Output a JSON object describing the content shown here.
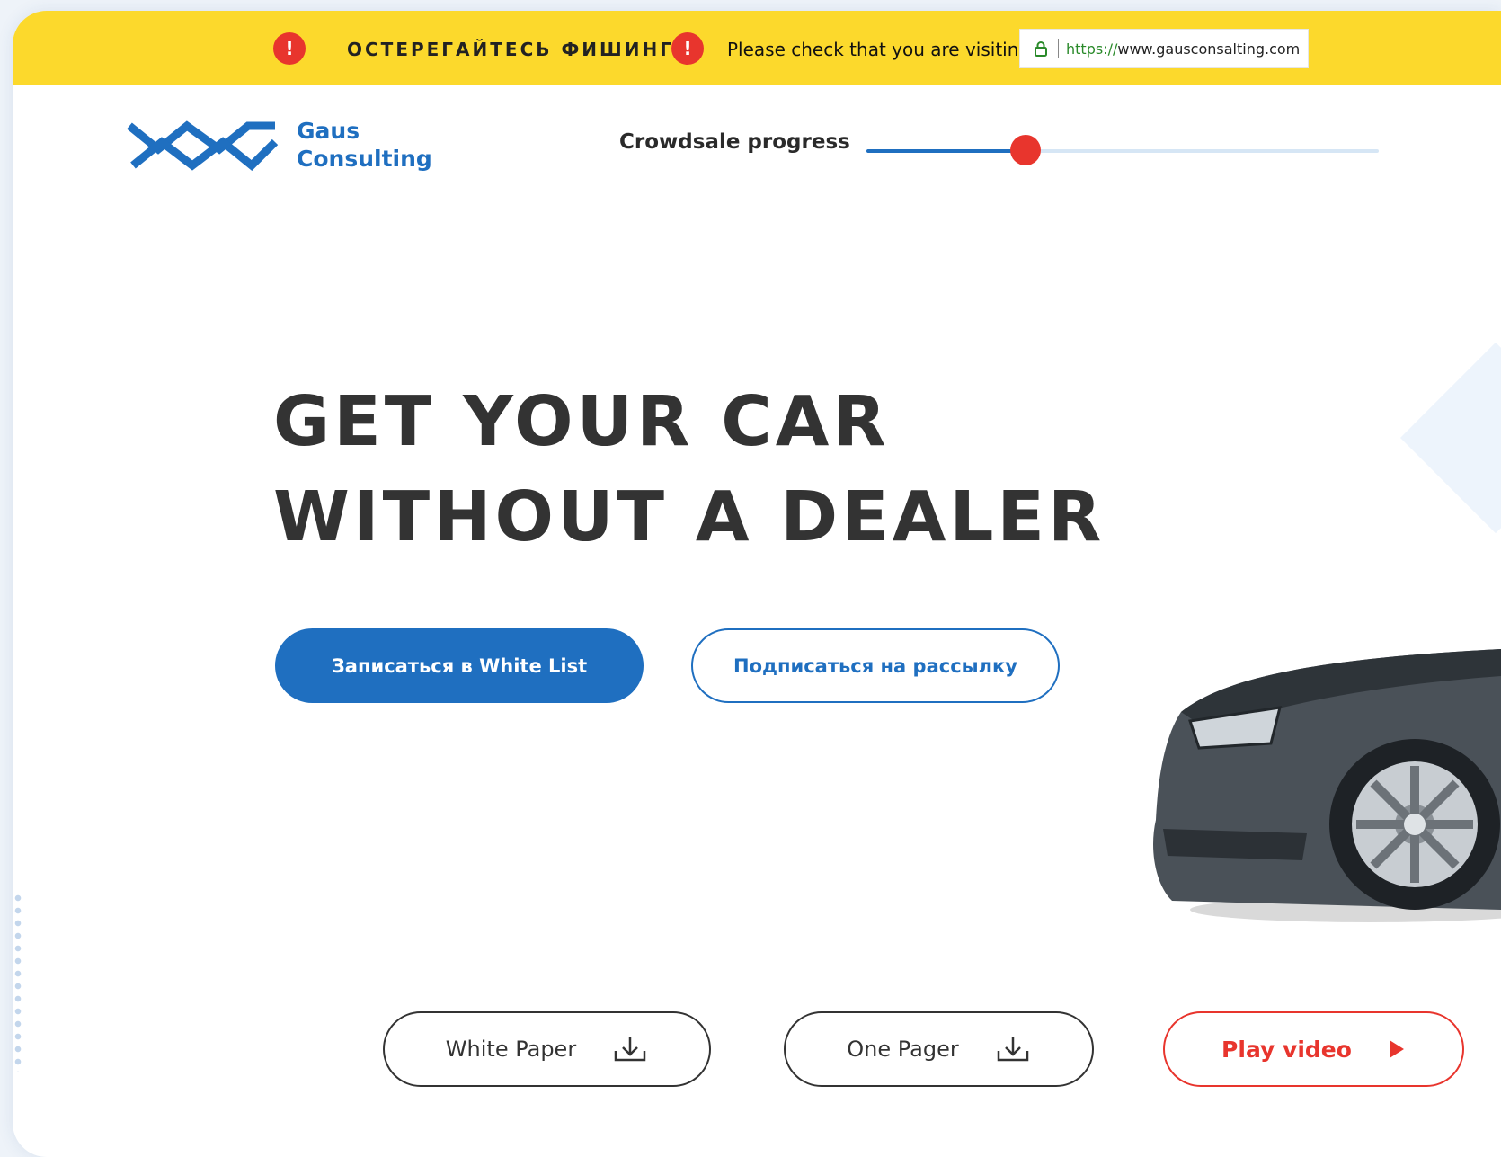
{
  "banner": {
    "warning_title": "ОСТЕРЕГАЙТЕСЬ ФИШИНГА",
    "warning_text": "Please check that you are visiting",
    "url_scheme": "https://",
    "url_host": "www.gausconsalting.com",
    "warning_icon_glyph": "!",
    "bg_color": "#fcd92c",
    "alert_color": "#e8352d"
  },
  "header": {
    "brand_line1": "Gaus",
    "brand_line2": "Consulting",
    "brand_color": "#1f6fc0",
    "progress_label": "Crowdsale progress",
    "progress_fraction": 0.31
  },
  "hero": {
    "headline_line1": "GET YOUR CAR",
    "headline_line2": "WITHOUT A DEALER"
  },
  "actions": {
    "whitelist_label": "Записаться в White List",
    "subscribe_label": "Подписаться на рассылку",
    "whitepaper_label": "White Paper",
    "onepager_label": "One Pager",
    "video_label": "Play video"
  },
  "icons": {
    "warning": "exclamation-icon",
    "lock": "lock-icon",
    "download": "download-icon",
    "play": "play-icon"
  }
}
